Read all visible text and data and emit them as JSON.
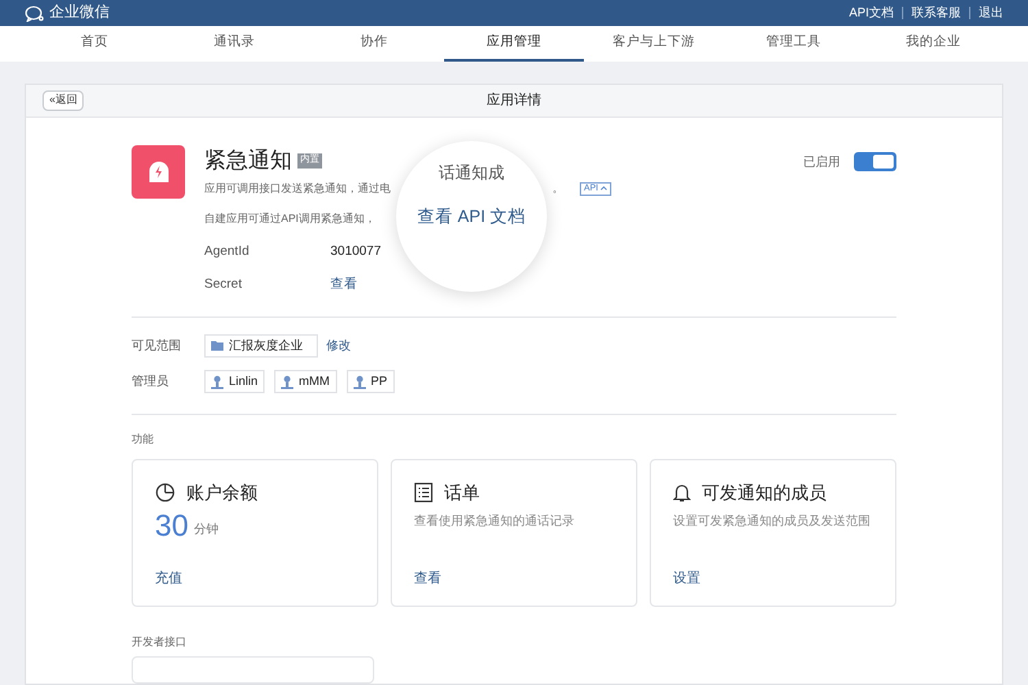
{
  "top_bar": {
    "brand": "企业微信",
    "links": [
      "API文档",
      "联系客服",
      "退出"
    ]
  },
  "nav": [
    {
      "label": "首页",
      "selected": false
    },
    {
      "label": "通讯录",
      "selected": false
    },
    {
      "label": "协作",
      "selected": false
    },
    {
      "label": "应用管理",
      "selected": true
    },
    {
      "label": "客户与上下游",
      "selected": false
    },
    {
      "label": "管理工具",
      "selected": false
    },
    {
      "label": "我的企业",
      "selected": false
    }
  ],
  "panel": {
    "back_icon": "«",
    "back": "返回",
    "title": "应用详情"
  },
  "app": {
    "name": "紧急通知",
    "tag": "内置",
    "description": "应用可调用接口发送紧急通知，通过电",
    "description_tail": "。",
    "api_badge": "API",
    "note": "自建应用可通过API调用紧急通知，",
    "status": "已启用",
    "enabled": true,
    "fields": [
      {
        "label": "AgentId",
        "value": "3010077",
        "kind": "text"
      },
      {
        "label": "Secret",
        "value": "查看",
        "kind": "link"
      }
    ]
  },
  "magnifier": {
    "peek": "话通知成",
    "link": "查看 API 文档"
  },
  "visibility": {
    "label": "可见范围",
    "department": "汇报灰度企业",
    "edit": "修改"
  },
  "admins": {
    "label": "管理员",
    "members": [
      "Linlin",
      "mMM",
      "PP"
    ]
  },
  "features": {
    "heading": "功能",
    "cards": [
      {
        "kind": "balance",
        "title": "账户余额",
        "amount": "30",
        "unit": "分钟",
        "action": "充值"
      },
      {
        "kind": "records",
        "title": "话单",
        "description": "查看使用紧急通知的通话记录",
        "action": "查看"
      },
      {
        "kind": "members",
        "title": "可发通知的成员",
        "description": "设置可发紧急通知的成员及发送范围",
        "action": "设置"
      }
    ]
  },
  "developer": {
    "heading": "开发者接口"
  }
}
